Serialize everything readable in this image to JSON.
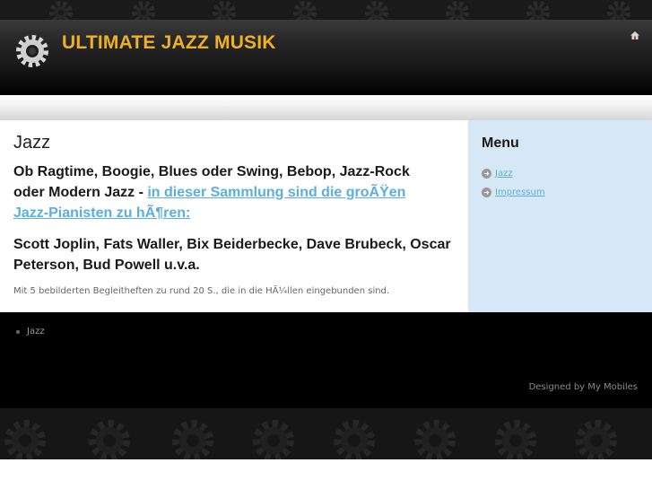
{
  "header": {
    "site_title": "ULTIMATE JAZZ MUSIK",
    "icons": {
      "logo": "gear-icon",
      "home": "home-icon"
    }
  },
  "content": {
    "title": "Jazz",
    "lead_text": "Ob Ragtime, Boogie, Blues oder Swing, Bebop, Jazz-Rock oder Modern Jazz - ",
    "lead_link": "in dieser Sammlung sind die groÃŸen Jazz-Pianisten zu hÃ¶ren:",
    "names": "Scott Joplin, Fats Waller, Bix Beiderbecke, Dave Brubeck, Oscar Peterson, Bud Powell u.v.a.",
    "note": "Mit 5 bebilderten Begleitheften zu rund 20 S., die in die HÃ¼llen eingebunden sind."
  },
  "sidebar": {
    "title": "Menu",
    "items": [
      {
        "label": "Jazz"
      },
      {
        "label": "Impressum"
      }
    ]
  },
  "footer": {
    "links": [
      {
        "label": "Jazz"
      }
    ],
    "credit": "Designed by My Mobiles"
  },
  "colors": {
    "title_accent": "#f0b020",
    "link": "#5aaee0",
    "sidebar_bg": "#d6e8f6"
  }
}
